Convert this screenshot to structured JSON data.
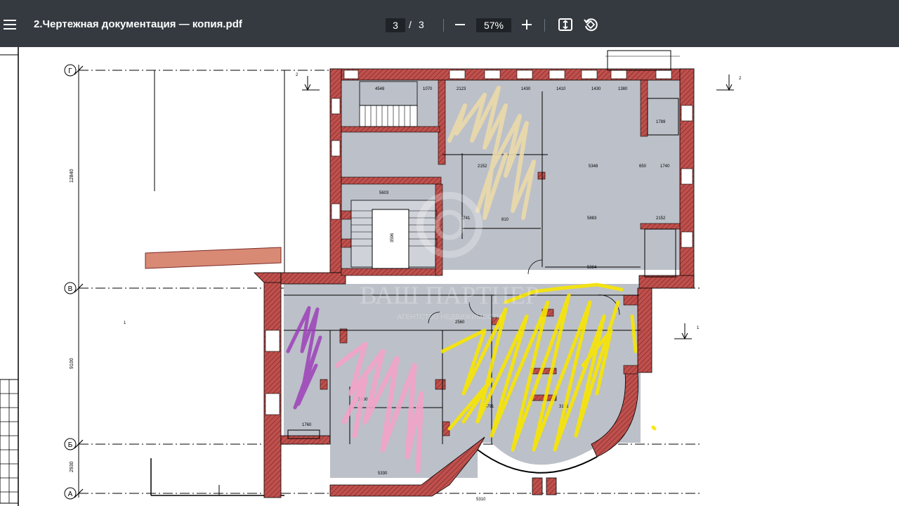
{
  "toolbar": {
    "menu_icon": "hamburger-menu-icon",
    "document_title": "2.Чертежная документация — копия.pdf",
    "current_page": "3",
    "page_separator": "/",
    "total_pages": "3",
    "zoom_out_icon": "minus-icon",
    "zoom_level": "57%",
    "zoom_in_icon": "plus-icon",
    "fit_icon": "fit-page-icon",
    "rotate_icon": "rotate-icon",
    "background_color": "#343a40"
  },
  "drawing": {
    "axis_labels": [
      "Г",
      "В",
      "Б",
      "А"
    ],
    "dimensions": {
      "vertical_1": "12840",
      "vertical_2": "9100",
      "vertical_3": "2930",
      "rooms": [
        "4548",
        "1070",
        "2123",
        "1430",
        "1410",
        "1430",
        "1380",
        "5348",
        "5883",
        "5884",
        "5603",
        "3596",
        "2560",
        "1760",
        "3300",
        "4791",
        "3195",
        "5310",
        "1741",
        "810",
        "2152",
        "1789",
        "650",
        "1740"
      ],
      "section_mark": "1",
      "section_mark_2": "2"
    },
    "watermark": "ВАШ ПАРТНЕР",
    "watermark_sub": "АГЕНТСТВО НЕДВИЖИМОСТИ",
    "colors": {
      "wall_hatch": "#c0504d",
      "floor_fill": "#bcc0c8",
      "purple_marker": "#9c3fb8",
      "pink_marker": "#f2a3c8",
      "yellow_marker": "#f7e600",
      "beige_marker": "#ead9a8",
      "annex_fill": "#d98a75"
    }
  }
}
